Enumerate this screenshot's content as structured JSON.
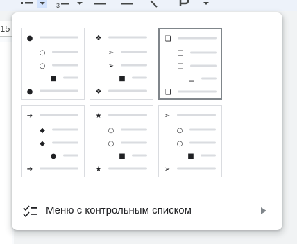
{
  "toolbar": {
    "icons": [
      "bulleted-list-icon",
      "dropdown-arrow-icon",
      "numbered-list-icon",
      "dropdown-arrow-icon",
      "decrease-indent-icon",
      "increase-indent-icon",
      "clear-formatting-icon",
      "input-tools-icon",
      "dropdown-arrow-icon"
    ]
  },
  "ruler": {
    "number": "15"
  },
  "bullet_presets": [
    {
      "name": "filled-circle-hollow-circle-square",
      "glyphs": [
        "●",
        "○",
        "○",
        "■",
        "●"
      ],
      "selected": false
    },
    {
      "name": "diamond-arrow-square",
      "glyphs": [
        "❖",
        "➢",
        "➢",
        "■",
        "❖"
      ],
      "selected": false
    },
    {
      "name": "3d-box",
      "glyphs": [
        "❏",
        "❏",
        "❏",
        "❏",
        "❏"
      ],
      "selected": true
    },
    {
      "name": "arrow-diamond-circle",
      "glyphs": [
        "➔",
        "◆",
        "◆",
        "●",
        "➔"
      ],
      "selected": false
    },
    {
      "name": "star-circle-square",
      "glyphs": [
        "★",
        "○",
        "○",
        "■",
        "★"
      ],
      "selected": false
    },
    {
      "name": "arrowhead-circle-square",
      "glyphs": [
        "➢",
        "○",
        "○",
        "■",
        "➢"
      ],
      "selected": false
    }
  ],
  "checklist_menu": {
    "icon": "checklist-icon",
    "label": "Меню с контрольным списком",
    "arrow": "submenu-arrow-icon"
  },
  "colors": {
    "menu_bg": "#ffffff",
    "line": "#dadce0",
    "glyph": "#202124",
    "selected_border": "#80868b",
    "arrow": "#80868b"
  }
}
